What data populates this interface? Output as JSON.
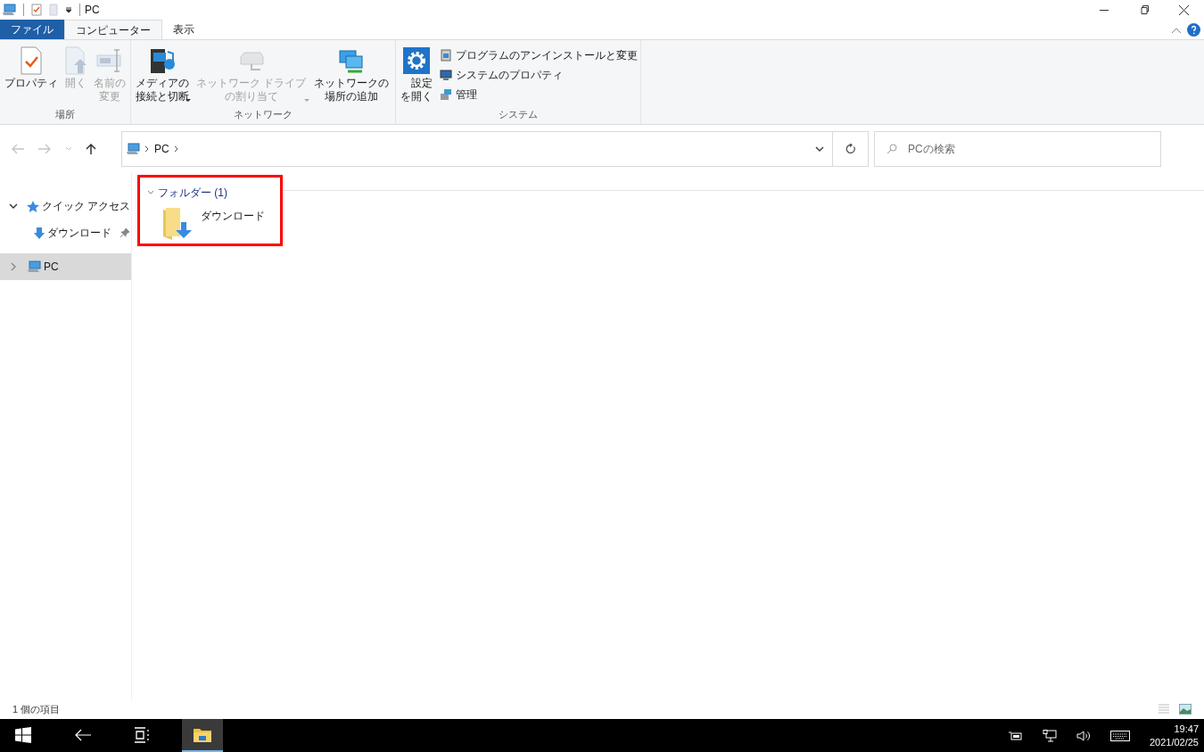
{
  "window": {
    "title": "PC"
  },
  "ribbon_tabs": [
    {
      "label": "ファイル",
      "kind": "file",
      "selected": false
    },
    {
      "label": "コンピューター",
      "kind": "tab",
      "selected": true
    },
    {
      "label": "表示",
      "kind": "tab",
      "selected": false
    }
  ],
  "ribbon_groups": [
    {
      "label": "場所",
      "items": [
        {
          "kind": "large",
          "label": "プロパティ",
          "disabled": false,
          "dropdown": false
        },
        {
          "kind": "large",
          "label": "開く",
          "disabled": true,
          "dropdown": false
        },
        {
          "kind": "large",
          "label": "名前の変更",
          "disabled": true,
          "dropdown": false
        }
      ]
    },
    {
      "label": "ネットワーク",
      "items": [
        {
          "kind": "large",
          "label": "メディアの接続と切断",
          "disabled": false,
          "dropdown": true
        },
        {
          "kind": "large",
          "label": "ネットワーク ドライブの割り当て",
          "disabled": true,
          "dropdown": true
        },
        {
          "kind": "large",
          "label": "ネットワークの場所の追加",
          "disabled": false,
          "dropdown": false
        }
      ]
    },
    {
      "label": "システム",
      "items": [
        {
          "kind": "large",
          "label": "設定を開く",
          "disabled": false,
          "dropdown": false
        },
        {
          "kind": "small",
          "label": "プログラムのアンインストールと変更",
          "disabled": false,
          "dropdown": false
        },
        {
          "kind": "small",
          "label": "システムのプロパティ",
          "disabled": false,
          "dropdown": false
        },
        {
          "kind": "small",
          "label": "管理",
          "disabled": false,
          "dropdown": false
        }
      ]
    }
  ],
  "navigation": {
    "back_disabled": true,
    "forward_disabled": true,
    "up_disabled": false
  },
  "address": {
    "breadcrumbs": [
      "PC"
    ]
  },
  "search": {
    "placeholder": "PCの検索"
  },
  "sidebar": {
    "items": [
      {
        "label": "クイック アクセス",
        "expanded": true,
        "selected": false,
        "pinned": false,
        "children": [
          {
            "label": "ダウンロード",
            "selected": false,
            "pinned": true
          }
        ]
      },
      {
        "label": "PC",
        "expanded": false,
        "selected": true,
        "pinned": false
      }
    ]
  },
  "content": {
    "groups": [
      {
        "header": "フォルダー (1)",
        "expanded": true,
        "highlighted": true,
        "items": [
          {
            "label": "ダウンロード"
          }
        ]
      }
    ]
  },
  "status_bar": {
    "text": "1 個の項目"
  },
  "taskbar": {
    "apps": [
      {
        "kind": "start",
        "selected": false
      },
      {
        "kind": "back",
        "selected": false
      },
      {
        "kind": "taskview",
        "selected": false
      },
      {
        "kind": "explorer",
        "selected": true
      }
    ],
    "time": "19:47",
    "date": "2021/02/25"
  }
}
